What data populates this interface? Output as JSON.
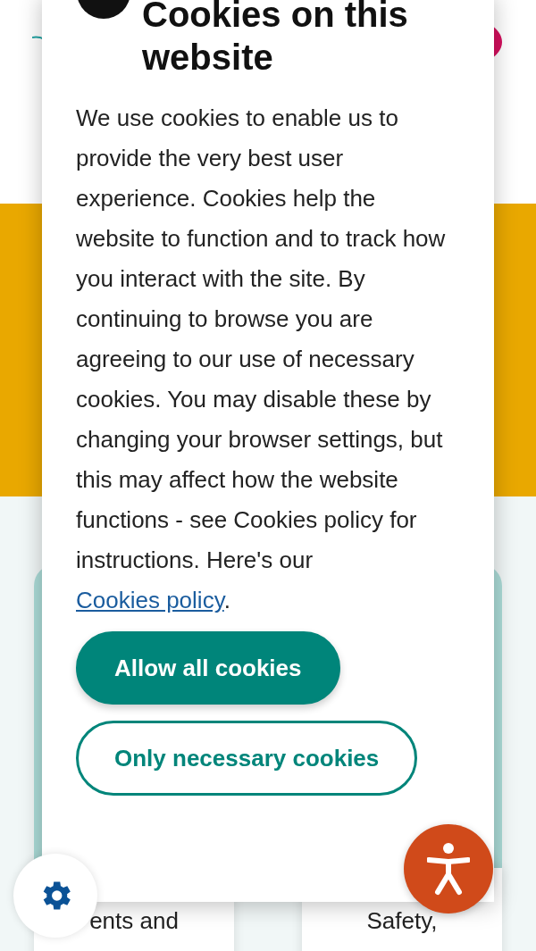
{
  "dialog": {
    "title": "Cookies on this website",
    "body": "We use cookies to enable us to provide the very best user experience. Cookies help the website to function and to track how you interact with the site. By continuing to browse you are agreeing to our use of necessary cookies. You may disable these by changing your browser settings, but this may affect how the website functions - see Cookies policy for instructions. Here's our ",
    "link": "Cookies policy",
    "after_link": ".",
    "buttons": [
      {
        "label": "Allow all cookies",
        "kind": "primary"
      },
      {
        "label": "Only necessary cookies",
        "kind": "secondary"
      }
    ]
  },
  "background_cards": [
    {
      "text": "ents and"
    },
    {
      "text": "Safety,"
    }
  ]
}
